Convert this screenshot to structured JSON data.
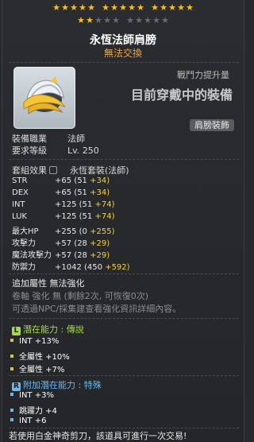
{
  "stars": {
    "row1_on": 15,
    "row1_total": 15,
    "row2_on": 2,
    "row2_total": 10
  },
  "item": {
    "name": "永恆法師肩膀",
    "trade_status": "無法交換",
    "attack_power_label": "戰鬥力提升量",
    "equipped_text": "目前穿戴中的裝備",
    "slot": "肩膀裝飾"
  },
  "requirements": [
    {
      "key": "裝備職業",
      "value": "法師"
    },
    {
      "key": "要求等級",
      "value": "Lv. 250"
    }
  ],
  "set": {
    "label": "套組效果",
    "name": "永恆套裝(法師)"
  },
  "stats": [
    {
      "name": "STR",
      "total": "+65",
      "base": "(51",
      "bonus": "+34)"
    },
    {
      "name": "DEX",
      "total": "+65",
      "base": "(51",
      "bonus": "+34)"
    },
    {
      "name": "INT",
      "total": "+125",
      "base": "(51",
      "bonus": "+74)"
    },
    {
      "name": "LUK",
      "total": "+125",
      "base": "(51",
      "bonus": "+74)"
    },
    {
      "name": "最大HP",
      "total": "+255",
      "base": "(0",
      "bonus": "+255)"
    },
    {
      "name": "攻擊力",
      "total": "+57",
      "base": "(28",
      "bonus": "+29)"
    },
    {
      "name": "魔法攻擊力",
      "total": "+57",
      "base": "(28",
      "bonus": "+29)"
    },
    {
      "name": "防禦力",
      "total": "+1042",
      "base": "(450",
      "bonus": "+592)"
    }
  ],
  "extra": {
    "additional_attr": "追加屬性 無法強化",
    "scroll_info": "卷軸 強化 無 (剩餘2次, 可恢復0次)",
    "npc_info": "可透過NPC/採集建查看強化資訊詳細內容。"
  },
  "potential": {
    "badge": "L",
    "label": "潛在能力 : 傳說",
    "lines": [
      "INT +13%",
      "全屬性 +10%",
      "全屬性 +7%"
    ]
  },
  "additional_potential": {
    "badge": "R",
    "label": "附加潛在能力 : 特殊",
    "lines": [
      "INT +3%",
      "跳躍力 +4",
      "INT +6"
    ]
  },
  "footer": "若使用白金神奇剪刀，該道具可進行一次交易!",
  "colors": {
    "gold": "#f5c021",
    "orange": "#f2a33a",
    "legend": "#a6d94b",
    "special": "#6fb7ea"
  }
}
